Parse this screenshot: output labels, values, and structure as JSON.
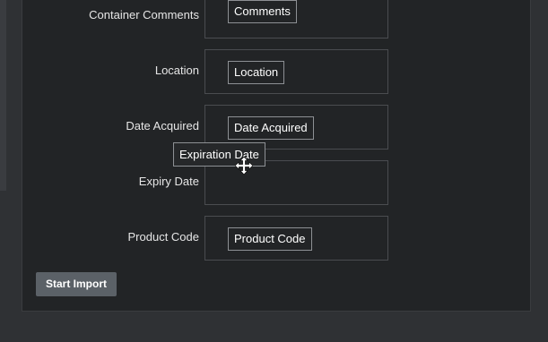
{
  "fields": [
    {
      "label": "Container Comments",
      "chip": "Comments"
    },
    {
      "label": "Location",
      "chip": "Location"
    },
    {
      "label": "Date Acquired",
      "chip": "Date Acquired"
    },
    {
      "label": "Expiry Date",
      "chip": ""
    },
    {
      "label": "Product Code",
      "chip": "Product Code"
    }
  ],
  "dragging_chip": "Expiration Date",
  "start_import_label": "Start Import",
  "colors": {
    "background": "#2f3134",
    "panel": "#222426",
    "box_border": "#4a4c50",
    "chip_border": "#8d9094",
    "button": "#5b6167"
  },
  "cursor": "move-cursor-icon"
}
